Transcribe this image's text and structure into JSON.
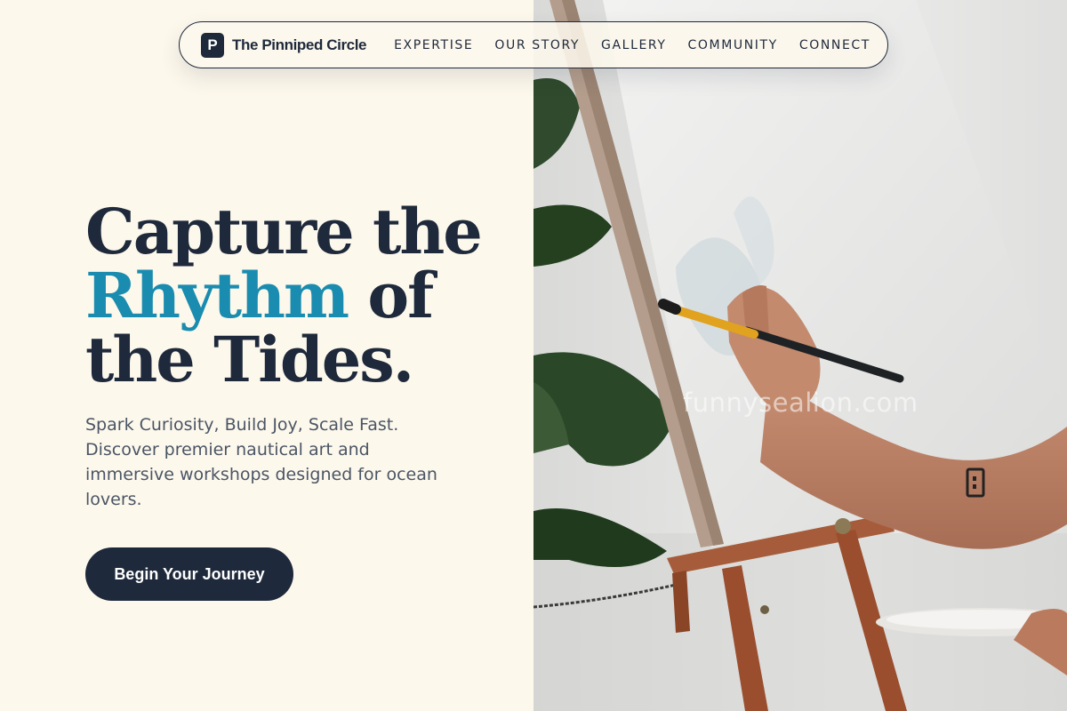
{
  "brand": {
    "logo_letter": "P",
    "name": "The Pinniped Circle"
  },
  "nav": {
    "links": [
      {
        "label": "EXPERTISE"
      },
      {
        "label": "OUR STORY"
      },
      {
        "label": "GALLERY"
      },
      {
        "label": "COMMUNITY"
      },
      {
        "label": "CONNECT"
      }
    ]
  },
  "hero": {
    "title_line1": "Capture the",
    "title_accent": "Rhythm",
    "title_line2_rest": " of",
    "title_line3": "the Tides.",
    "subtitle": "Spark Curiosity, Build Joy, Scale Fast. Discover premier nautical art and immersive workshops designed for ocean lovers.",
    "cta_label": "Begin Your Journey"
  },
  "photo": {
    "watermark": "funnysealion.com"
  },
  "colors": {
    "ink": "#1e293b",
    "accent": "#1a8caf",
    "background": "#fdf8ec",
    "body_text": "#4a5565"
  }
}
